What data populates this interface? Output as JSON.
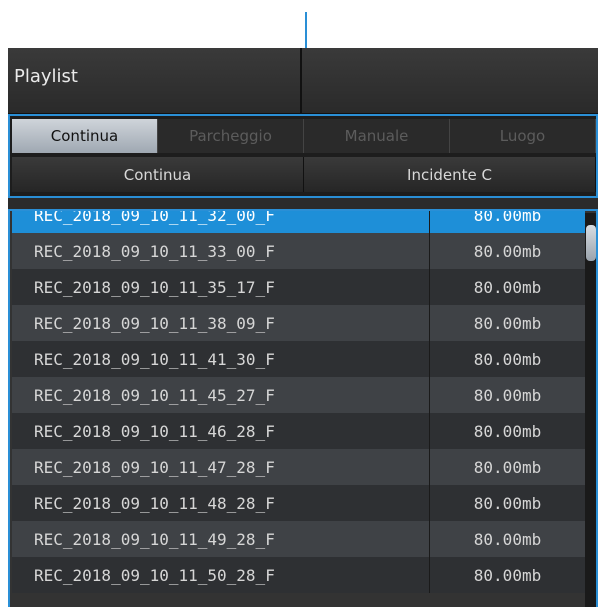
{
  "colors": {
    "accent": "#2a8fd6",
    "selected_row": "#1e8fd8"
  },
  "window": {
    "title": "Playlist"
  },
  "tabs": [
    {
      "label": "Continua",
      "active": true
    },
    {
      "label": "Parcheggio",
      "active": false
    },
    {
      "label": "Manuale",
      "active": false
    },
    {
      "label": "Luogo",
      "active": false
    }
  ],
  "subtabs": [
    {
      "label": "Continua"
    },
    {
      "label": "Incidente C"
    }
  ],
  "files": [
    {
      "name": "REC_2018_09_10_11_32_00_F",
      "size": "80.00mb",
      "selected": true
    },
    {
      "name": "REC_2018_09_10_11_33_00_F",
      "size": "80.00mb"
    },
    {
      "name": "REC_2018_09_10_11_35_17_F",
      "size": "80.00mb"
    },
    {
      "name": "REC_2018_09_10_11_38_09_F",
      "size": "80.00mb"
    },
    {
      "name": "REC_2018_09_10_11_41_30_F",
      "size": "80.00mb"
    },
    {
      "name": "REC_2018_09_10_11_45_27_F",
      "size": "80.00mb"
    },
    {
      "name": "REC_2018_09_10_11_46_28_F",
      "size": "80.00mb"
    },
    {
      "name": "REC_2018_09_10_11_47_28_F",
      "size": "80.00mb"
    },
    {
      "name": "REC_2018_09_10_11_48_28_F",
      "size": "80.00mb"
    },
    {
      "name": "REC_2018_09_10_11_49_28_F",
      "size": "80.00mb"
    },
    {
      "name": "REC_2018_09_10_11_50_28_F",
      "size": "80.00mb"
    }
  ]
}
